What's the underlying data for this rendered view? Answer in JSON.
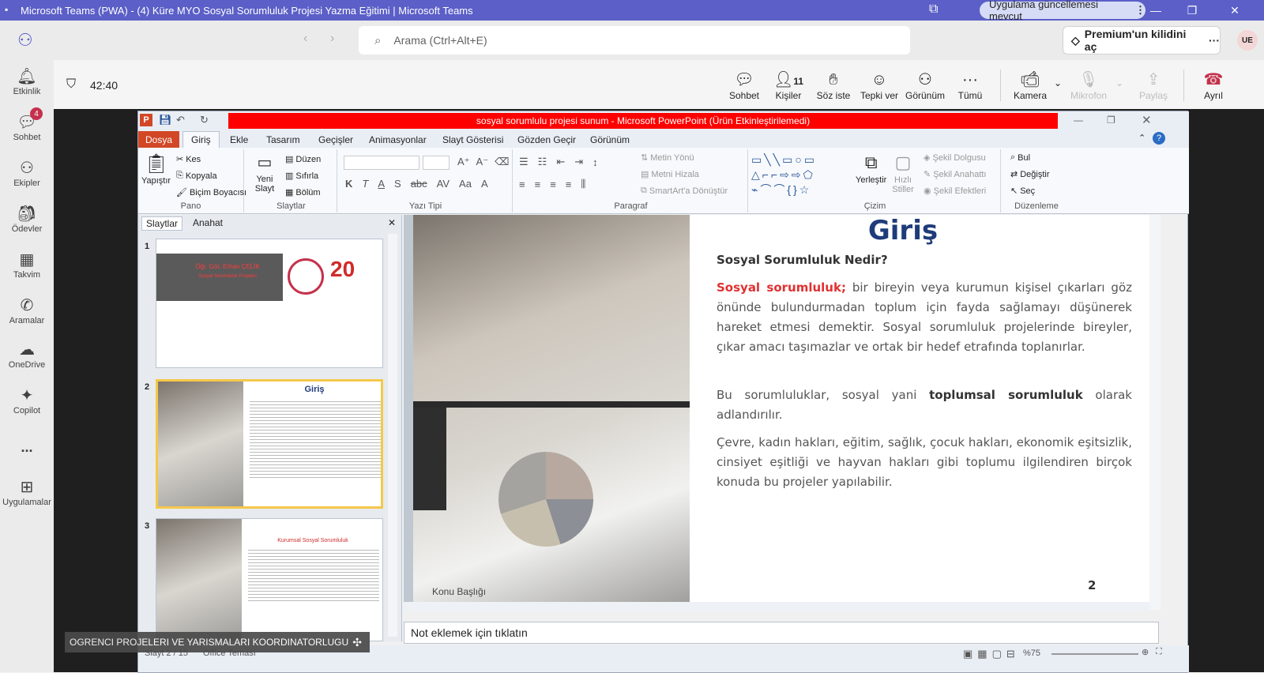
{
  "window": {
    "title": "Microsoft Teams (PWA) - (4) Küre MYO Sosyal Sorumluluk Projesi Yazma Eğitimi | Microsoft Teams",
    "update_label": "Uygulama güncellemesi mevcut"
  },
  "topbar": {
    "search_placeholder": "Arama (Ctrl+Alt+E)",
    "premium_label": "Premium'un kilidini aç",
    "avatar_initials": "UE"
  },
  "rail": {
    "items": [
      {
        "label": "Etkinlik"
      },
      {
        "label": "Sohbet",
        "badge": "4"
      },
      {
        "label": "Ekipler"
      },
      {
        "label": "Ödevler"
      },
      {
        "label": "Takvim"
      },
      {
        "label": "Aramalar"
      },
      {
        "label": "OneDrive"
      },
      {
        "label": "Copilot"
      },
      {
        "label": "..."
      },
      {
        "label": "Uygulamalar"
      }
    ]
  },
  "meeting": {
    "timer": "42:40",
    "participants_count": "11",
    "buttons": {
      "chat": "Sohbet",
      "people": "Kişiler",
      "raise": "Söz iste",
      "react": "Tepki ver",
      "view": "Görünüm",
      "more": "Tümü",
      "camera": "Kamera",
      "mic": "Mikrofon",
      "share": "Paylaş",
      "leave": "Ayrıl"
    }
  },
  "ppt": {
    "title": "sosyal sorumlulu projesi sunum  -  Microsoft PowerPoint (Ürün Etkinleştirilemedi)",
    "tabs": [
      "Dosya",
      "Giriş",
      "Ekle",
      "Tasarım",
      "Geçişler",
      "Animasyonlar",
      "Slayt Gösterisi",
      "Gözden Geçir",
      "Görünüm"
    ],
    "ribbon": {
      "paste": "Yapıştır",
      "cut": "Kes",
      "copy": "Kopyala",
      "painter": "Biçim Boyacısı",
      "g_pano": "Pano",
      "new_slide": "Yeni Slayt",
      "layout": "Düzen",
      "reset": "Sıfırla",
      "section": "Bölüm",
      "g_slaytlar": "Slaytlar",
      "g_font": "Yazı Tipi",
      "text_dir": "Metin Yönü",
      "align_text": "Metni Hizala",
      "smartart": "SmartArt'a Dönüştür",
      "g_para": "Paragraf",
      "arrange": "Yerleştir",
      "quick_styles": "Hızlı Stiller",
      "fill": "Şekil Dolgusu",
      "outline": "Şekil Anahattı",
      "effects": "Şekil Efektleri",
      "g_draw": "Çizim",
      "find": "Bul",
      "replace": "Değiştir",
      "select": "Seç",
      "g_edit": "Düzenleme"
    },
    "panel_tabs": [
      "Slaytlar",
      "Anahat"
    ],
    "thumbs": [
      {
        "num": "1",
        "author": "Öğr. Gör. Erhan ÇELİK",
        "sub": "Sosyal Sorumluluk Projeleri"
      },
      {
        "num": "2",
        "heading": "Giriş"
      },
      {
        "num": "3",
        "heading": "Kurumsal Sosyal Sorumluluk"
      }
    ],
    "slide": {
      "title": "Giriş",
      "subtitle": "Sosyal Sorumluluk Nedir?",
      "p1_bold": "Sosyal sorumluluk;",
      "p1": " bir bireyin veya kurumun kişisel çıkarları göz önünde bulundurmadan toplum için fayda sağlamayı düşünerek hareket etmesi demektir. Sosyal sorumluluk projelerinde bireyler, çıkar amacı taşımazlar ve ortak bir hedef etrafında toplanırlar.",
      "p2a": "Bu sorumluluklar, sosyal yani ",
      "p2_bold": "toplumsal sorumluluk",
      "p2b": " olarak adlandırılır.",
      "p3": "Çevre, kadın hakları, eğitim, sağlık, çocuk hakları, ekonomik eşitsizlik, cinsiyet eşitliği ve hayvan hakları gibi toplumu ilgilendiren birçok konuda bu projeler yapılabilir.",
      "page": "2",
      "photo_caption": "Konu Başlığı"
    },
    "notes_placeholder": "Not eklemek için tıklatın",
    "status": {
      "slide": "Slayt 2 / 15",
      "theme": "Office Teması",
      "zoom": "%75"
    }
  },
  "share_label": "OGRENCI PROJELERI VE YARISMALARI KOORDINATORLUGU"
}
